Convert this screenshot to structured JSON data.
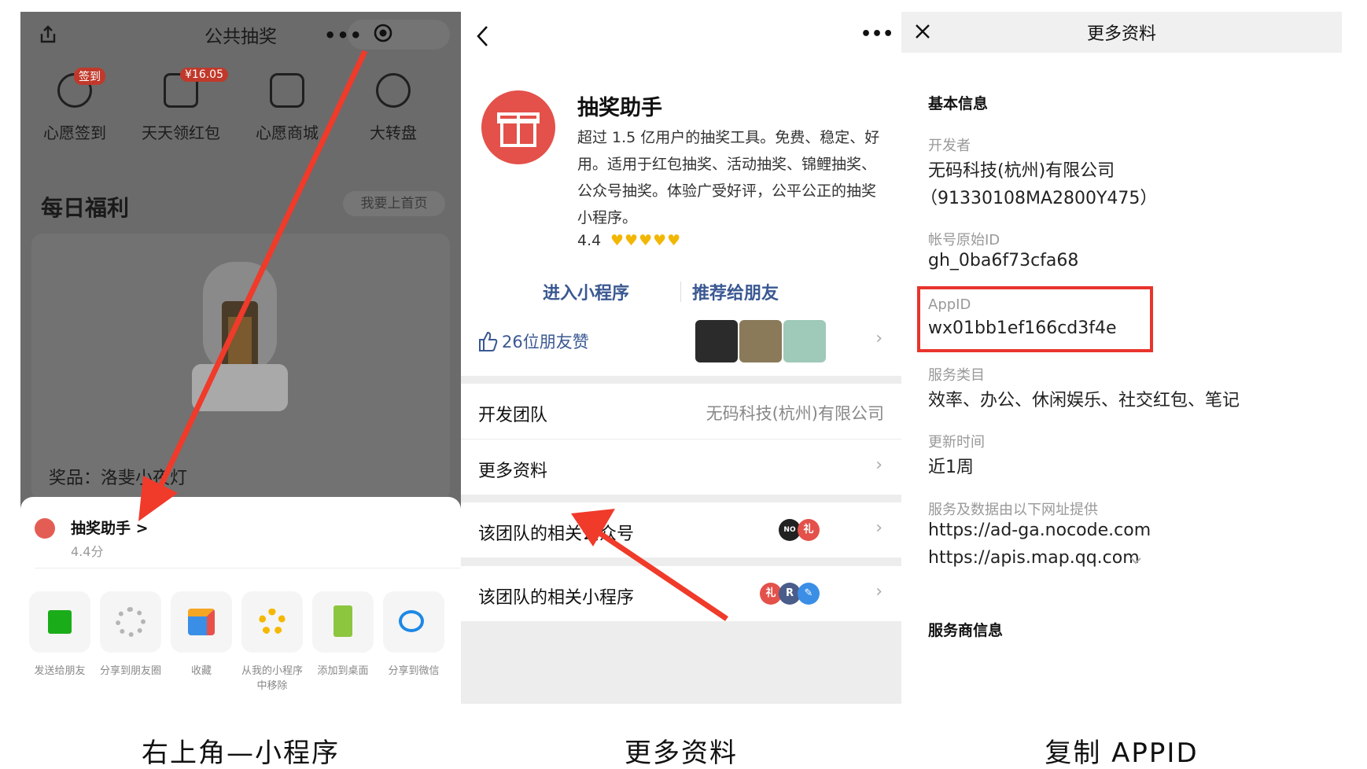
{
  "panel1": {
    "title": "公共抽奖",
    "grid": [
      {
        "label": "心愿签到",
        "badge": "签到",
        "icon": "heart-checkin-icon"
      },
      {
        "label": "天天领红包",
        "badge": "¥16.05",
        "icon": "red-packet-icon"
      },
      {
        "label": "心愿商城",
        "badge": "",
        "icon": "store-icon"
      },
      {
        "label": "大转盘",
        "badge": "",
        "icon": "wheel-icon"
      }
    ],
    "daily_title": "每日福利",
    "home_button": "我要上首页",
    "prize_label": "奖品：洛斐小夜灯",
    "sheet": {
      "mini_name": "抽奖助手 >",
      "mini_score": "4.4分",
      "actions": [
        {
          "label": "发送给朋友",
          "icon": "send-icon"
        },
        {
          "label": "分享到朋友圈",
          "icon": "moments-icon"
        },
        {
          "label": "收藏",
          "icon": "cube-icon"
        },
        {
          "label": "从我的小程序中移除",
          "icon": "remove-icon"
        },
        {
          "label": "添加到桌面",
          "icon": "desktop-icon"
        },
        {
          "label": "分享到微信",
          "icon": "chat-icon"
        }
      ]
    }
  },
  "panel2": {
    "name": "抽奖助手",
    "description": "超过 1.5 亿用户的抽奖工具。免费、稳定、好用。适用于红包抽奖、活动抽奖、锦鲤抽奖、公众号抽奖。体验广受好评，公平公正的抽奖小程序。",
    "rating": "4.4",
    "hearts": "♥♥♥♥♥",
    "rating_value": 4.4,
    "enter_button": "进入小程序",
    "recommend_button": "推荐给朋友",
    "likes_text": "26位朋友赞",
    "rows": {
      "dev_team_label": "开发团队",
      "dev_team_value": "无码科技(杭州)有限公司",
      "more_info_label": "更多资料",
      "official_label": "该团队的相关公众号",
      "mini_label": "该团队的相关小程序"
    },
    "official_avatars": [
      "NO CODE",
      "礼"
    ],
    "mini_avatars": [
      "礼",
      "R",
      "✎"
    ]
  },
  "panel3": {
    "title": "更多资料",
    "basic_section": "基本信息",
    "developer_label": "开发者",
    "developer_value": "无码科技(杭州)有限公司",
    "developer_code": "（91330108MA2800Y475）",
    "original_id_label": "帐号原始ID",
    "original_id_value": "gh_0ba6f73cfa68",
    "appid_label": "AppID",
    "appid_value": "wx01bb1ef166cd3f4e",
    "category_label": "服务类目",
    "category_value": "效率、办公、休闲娱乐、社交红包、笔记",
    "update_label": "更新时间",
    "update_value": "近1周",
    "domains_label": "服务及数据由以下网址提供",
    "domain_1": "https://ad-ga.nocode.com",
    "domain_2": "https://apis.map.qq.com",
    "provider_section": "服务商信息"
  },
  "captions": [
    "右上角—小程序",
    "更多资料",
    "复制 APPID"
  ],
  "colors": {
    "arrow": "#f03a2a",
    "highlight_box": "#e8342c",
    "link_blue": "#3a5892",
    "gift_red": "#e3514a",
    "heart_yellow": "#f2b705"
  }
}
